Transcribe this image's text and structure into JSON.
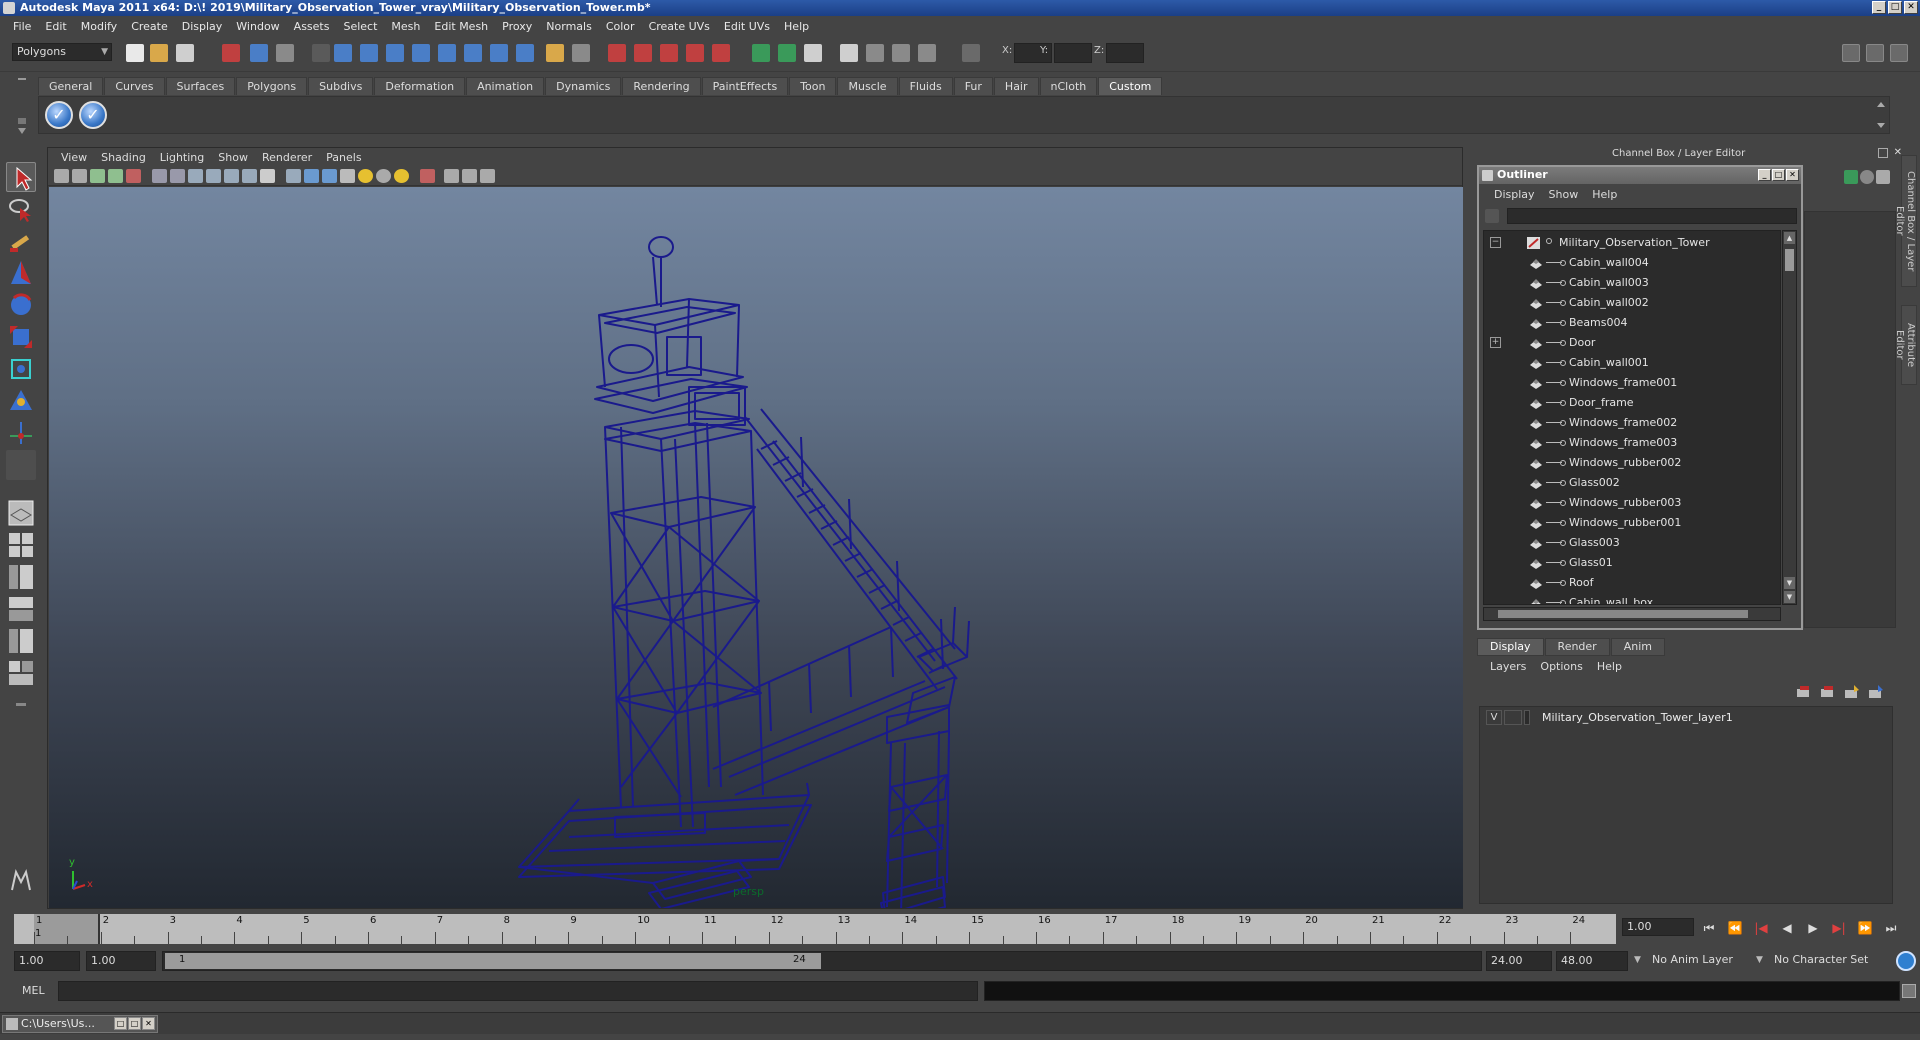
{
  "window": {
    "title": "Autodesk Maya 2011 x64: D:\\! 2019\\Military_Observation_Tower_vray\\Military_Observation_Tower.mb*",
    "btn_min": "_",
    "btn_max": "□",
    "btn_close": "✕"
  },
  "menubar": [
    "File",
    "Edit",
    "Modify",
    "Create",
    "Display",
    "Window",
    "Assets",
    "Select",
    "Mesh",
    "Edit Mesh",
    "Proxy",
    "Normals",
    "Color",
    "Create UVs",
    "Edit UVs",
    "Help"
  ],
  "statusline": {
    "mode": "Polygons",
    "x_label": "X:",
    "y_label": "Y:",
    "z_label": "Z:"
  },
  "shelf": {
    "tabs": [
      "General",
      "Curves",
      "Surfaces",
      "Polygons",
      "Subdivs",
      "Deformation",
      "Animation",
      "Dynamics",
      "Rendering",
      "PaintEffects",
      "Toon",
      "Muscle",
      "Fluids",
      "Fur",
      "Hair",
      "nCloth",
      "Custom"
    ],
    "active_tab": "Custom"
  },
  "viewport": {
    "menu": [
      "View",
      "Shading",
      "Lighting",
      "Show",
      "Renderer",
      "Panels"
    ],
    "camera_label": "persp",
    "axis_y": "y",
    "axis_x": "x",
    "wire_color": "#1a1a8c"
  },
  "channel_box": {
    "title": "Channel Box / Layer Editor",
    "side_tabs": [
      "Channel Box / Layer Editor",
      "Attribute Editor"
    ]
  },
  "outliner": {
    "title": "Outliner",
    "menu": [
      "Display",
      "Show",
      "Help"
    ],
    "root": "Military_Observation_Tower",
    "items": [
      {
        "label": "Cabin_wall004",
        "expand": ""
      },
      {
        "label": "Cabin_wall003",
        "expand": ""
      },
      {
        "label": "Cabin_wall002",
        "expand": ""
      },
      {
        "label": "Beams004",
        "expand": ""
      },
      {
        "label": "Door",
        "expand": "+"
      },
      {
        "label": "Cabin_wall001",
        "expand": ""
      },
      {
        "label": "Windows_frame001",
        "expand": ""
      },
      {
        "label": "Door_frame",
        "expand": ""
      },
      {
        "label": "Windows_frame002",
        "expand": ""
      },
      {
        "label": "Windows_frame003",
        "expand": ""
      },
      {
        "label": "Windows_rubber002",
        "expand": ""
      },
      {
        "label": "Glass002",
        "expand": ""
      },
      {
        "label": "Windows_rubber003",
        "expand": ""
      },
      {
        "label": "Windows_rubber001",
        "expand": ""
      },
      {
        "label": "Glass003",
        "expand": ""
      },
      {
        "label": "Glass01",
        "expand": ""
      },
      {
        "label": "Roof",
        "expand": ""
      },
      {
        "label": "Cabin_wall_box",
        "expand": ""
      }
    ],
    "root_expand": "−"
  },
  "layer_editor": {
    "tabs": [
      "Display",
      "Render",
      "Anim"
    ],
    "active_tab": "Display",
    "menu": [
      "Layers",
      "Options",
      "Help"
    ],
    "layer": {
      "visible": "V",
      "name": "Military_Observation_Tower_layer1"
    }
  },
  "timeline": {
    "ticks": [
      "1",
      "2",
      "3",
      "4",
      "5",
      "6",
      "7",
      "8",
      "9",
      "10",
      "11",
      "12",
      "13",
      "14",
      "15",
      "16",
      "17",
      "18",
      "19",
      "20",
      "21",
      "22",
      "23",
      "24"
    ],
    "current_marker": "1",
    "current_frame": "1.00",
    "playback": [
      "⏮",
      "⏪",
      "|◀",
      "◀",
      "▶",
      "▶|",
      "⏩",
      "⏭"
    ]
  },
  "range": {
    "start": "1.00",
    "playback_start": "1.00",
    "handle_start": "1",
    "handle_end": "24",
    "playback_end": "24.00",
    "end": "48.00",
    "anim_layer": "No Anim Layer",
    "character_set": "No Character Set"
  },
  "command": {
    "label": "MEL"
  },
  "taskbar": {
    "item": "C:\\Users\\Us..."
  }
}
